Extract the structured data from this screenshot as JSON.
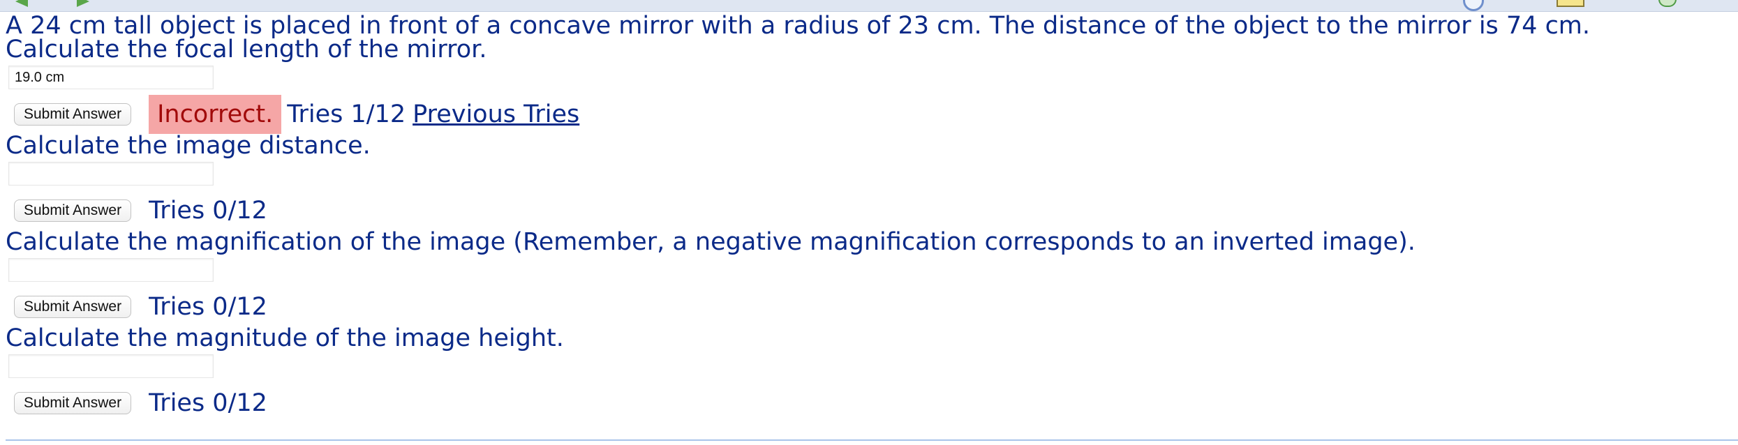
{
  "problem": {
    "intro": "A 24 cm tall object is placed in front of a concave mirror with a radius of 23 cm. The distance of the object to the mirror is 74 cm."
  },
  "questions": [
    {
      "prompt": "Calculate the focal length of the mirror.",
      "input_value": "19.0 cm",
      "submit_label": "Submit Answer",
      "status": "Incorrect.",
      "tries": "Tries 1/12",
      "previous_tries_link": "Previous Tries"
    },
    {
      "prompt": "Calculate the image distance.",
      "input_value": "",
      "submit_label": "Submit Answer",
      "tries": "Tries 0/12"
    },
    {
      "prompt": "Calculate the magnification of the image (Remember, a negative magnification corresponds to an inverted image).",
      "input_value": "",
      "submit_label": "Submit Answer",
      "tries": "Tries 0/12"
    },
    {
      "prompt": "Calculate the magnitude of the image height.",
      "input_value": "",
      "submit_label": "Submit Answer",
      "tries": "Tries 0/12"
    }
  ],
  "icons": {
    "back": "back-arrow-icon",
    "forward": "forward-arrow-icon",
    "help": "help-icon",
    "note": "note-icon",
    "refresh": "refresh-icon"
  },
  "colors": {
    "text": "#0b2a88",
    "incorrect_bg": "#f5a6a6",
    "incorrect_text": "#a10a0a"
  }
}
